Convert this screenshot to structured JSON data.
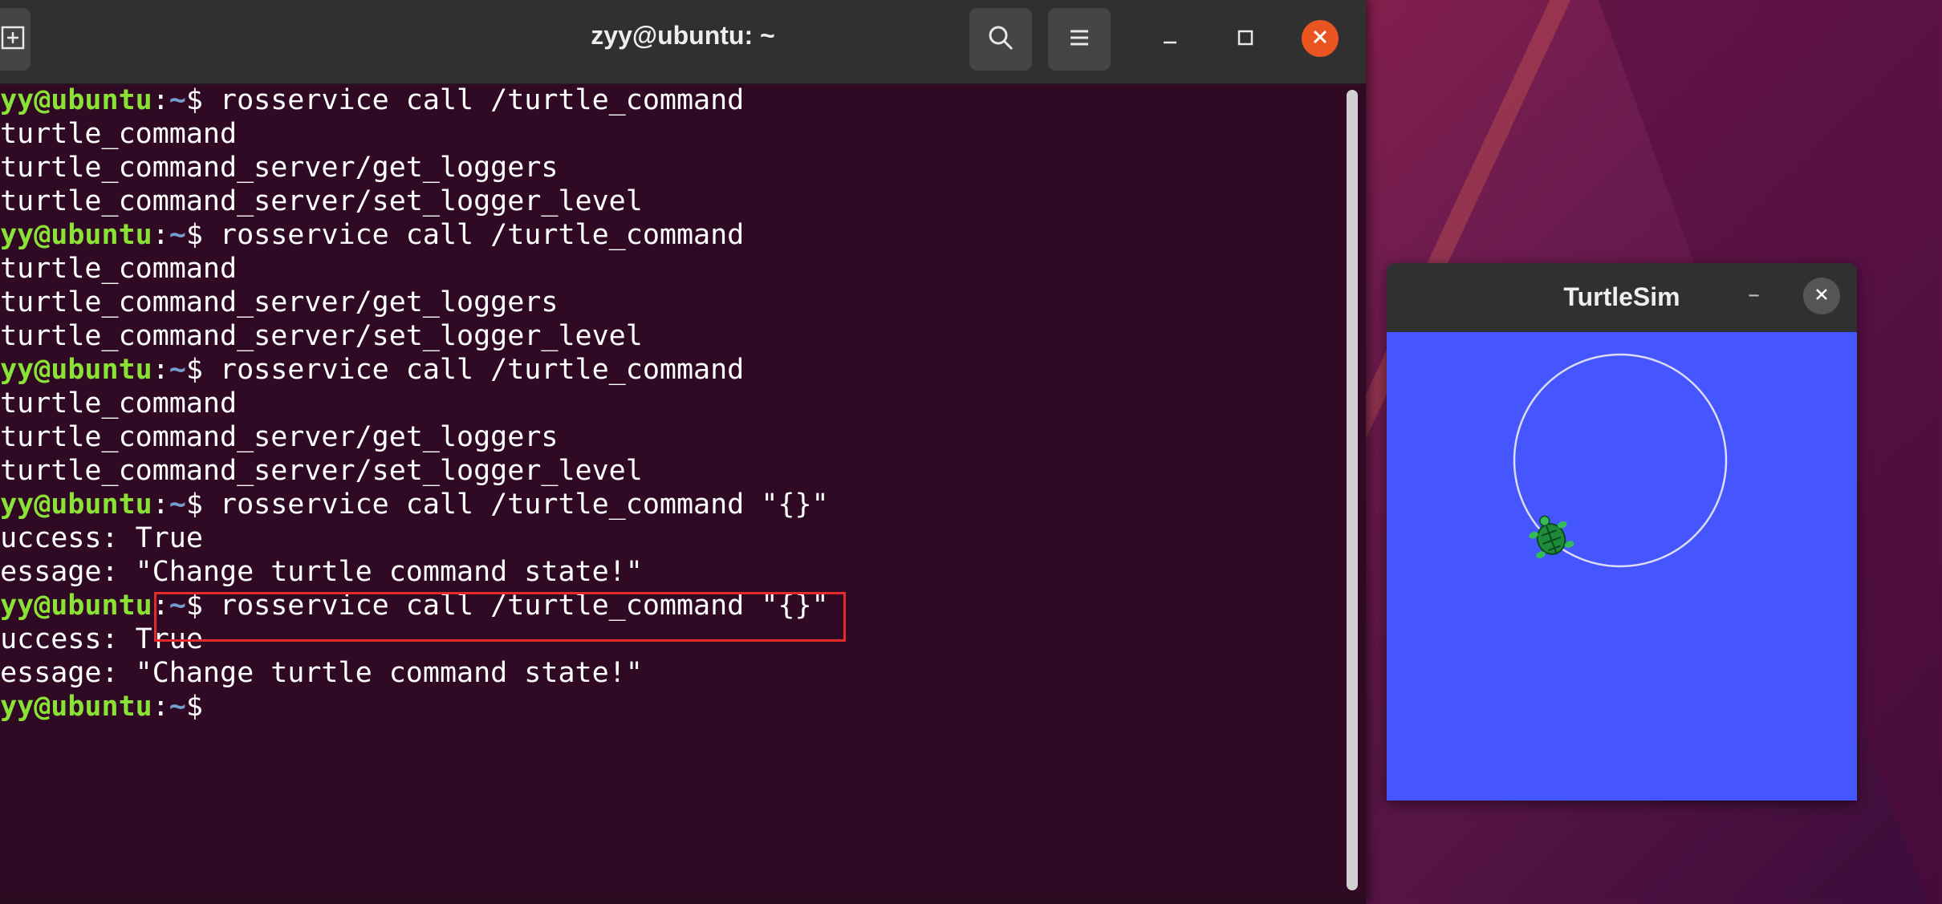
{
  "terminal": {
    "title": "zyy@ubuntu: ~",
    "new_tab_icon": "new-tab-icon",
    "search_icon": "search-icon",
    "menu_icon": "hamburger-menu-icon",
    "minimize_icon": "minimize-icon",
    "maximize_icon": "maximize-icon",
    "close_icon": "close-icon",
    "lines": [
      {
        "prompt": true,
        "user": "zyy@ubuntu",
        "colon": ":",
        "path": "~",
        "cmd": "$ rosservice call /turtle_command"
      },
      {
        "prompt": false,
        "text": "/turtle_command"
      },
      {
        "prompt": false,
        "text": "/turtle_command_server/get_loggers"
      },
      {
        "prompt": false,
        "text": "/turtle_command_server/set_logger_level"
      },
      {
        "prompt": true,
        "user": "zyy@ubuntu",
        "colon": ":",
        "path": "~",
        "cmd": "$ rosservice call /turtle_command"
      },
      {
        "prompt": false,
        "text": "/turtle_command"
      },
      {
        "prompt": false,
        "text": "/turtle_command_server/get_loggers"
      },
      {
        "prompt": false,
        "text": "/turtle_command_server/set_logger_level"
      },
      {
        "prompt": true,
        "user": "zyy@ubuntu",
        "colon": ":",
        "path": "~",
        "cmd": "$ rosservice call /turtle_command"
      },
      {
        "prompt": false,
        "text": "/turtle_command"
      },
      {
        "prompt": false,
        "text": "/turtle_command_server/get_loggers"
      },
      {
        "prompt": false,
        "text": "/turtle_command_server/set_logger_level"
      },
      {
        "prompt": true,
        "user": "zyy@ubuntu",
        "colon": ":",
        "path": "~",
        "cmd": "$ rosservice call /turtle_command \"{}\""
      },
      {
        "prompt": false,
        "text": "success: True"
      },
      {
        "prompt": false,
        "text": "message: \"Change turtle command state!\""
      },
      {
        "prompt": true,
        "user": "zyy@ubuntu",
        "colon": ":",
        "path": "~",
        "cmd": "$ rosservice call /turtle_command \"{}\""
      },
      {
        "prompt": false,
        "text": "success: True"
      },
      {
        "prompt": false,
        "text": "message: \"Change turtle command state!\""
      },
      {
        "prompt": true,
        "user": "zyy@ubuntu",
        "colon": ":",
        "path": "~",
        "cmd": "$ "
      }
    ]
  },
  "turtlesim": {
    "title": "TurtleSim",
    "minimize_label": "–",
    "close_icon": "close-icon",
    "background_color": "#4556ff",
    "turtle_icon": "turtle-icon"
  },
  "colors": {
    "terminal_bg": "#300a24",
    "user_green": "#8ae234",
    "path_blue": "#729fcf",
    "highlight_red": "#e32b2b",
    "close_orange": "#e95420"
  }
}
